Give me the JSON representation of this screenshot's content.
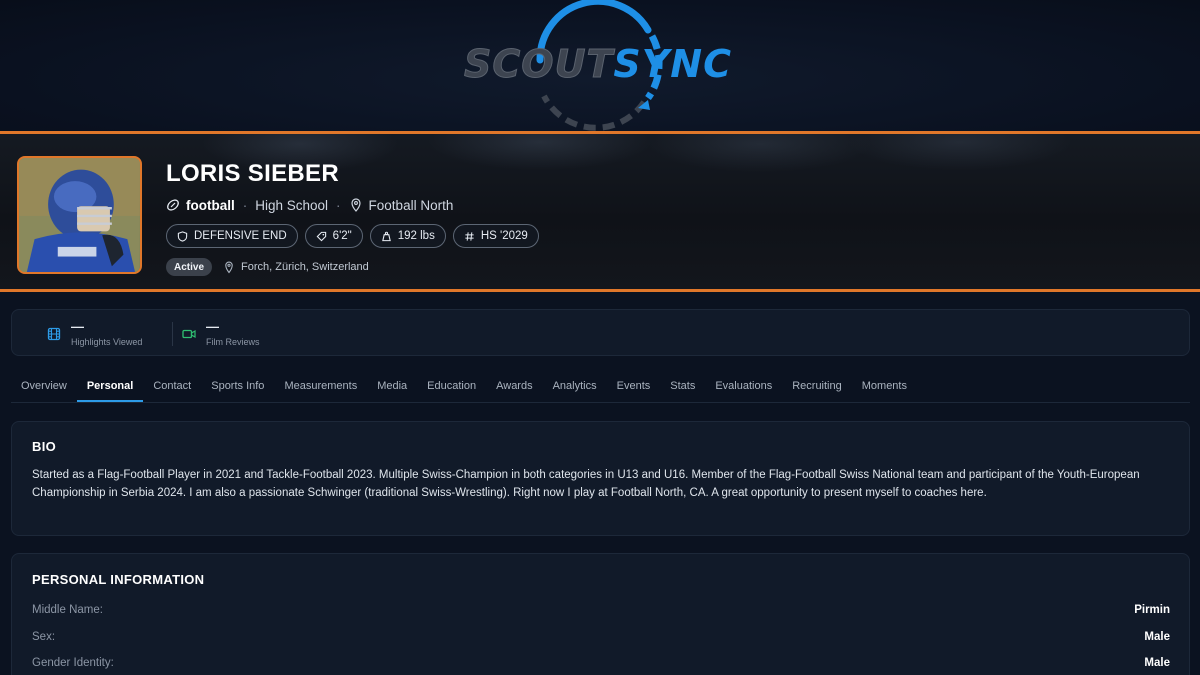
{
  "brand": {
    "logo_left": "SCOUT",
    "logo_right": "SYNC",
    "accent_orange": "#e0772a",
    "accent_blue": "#1e8fe6"
  },
  "profile": {
    "name": "LORIS SIEBER",
    "sport": "football",
    "level": "High School",
    "team": "Football North",
    "chips": [
      {
        "icon": "shield-icon",
        "label": "DEFENSIVE END"
      },
      {
        "icon": "tag-icon",
        "label": "6'2\""
      },
      {
        "icon": "weight-icon",
        "label": "192 lbs"
      },
      {
        "icon": "hash-icon",
        "label": "HS '2029"
      }
    ],
    "status": "Active",
    "location": "Forch, Zürich, Switzerland"
  },
  "stats": [
    {
      "icon": "film-icon",
      "value": "—",
      "label": "Highlights Viewed"
    },
    {
      "icon": "video-icon",
      "value": "—",
      "label": "Film Reviews"
    }
  ],
  "tabs": [
    {
      "label": "Overview"
    },
    {
      "label": "Personal",
      "active": true
    },
    {
      "label": "Contact"
    },
    {
      "label": "Sports Info"
    },
    {
      "label": "Measurements"
    },
    {
      "label": "Media"
    },
    {
      "label": "Education"
    },
    {
      "label": "Awards"
    },
    {
      "label": "Analytics"
    },
    {
      "label": "Events"
    },
    {
      "label": "Stats"
    },
    {
      "label": "Evaluations"
    },
    {
      "label": "Recruiting"
    },
    {
      "label": "Moments"
    }
  ],
  "bio": {
    "title": "BIO",
    "text": "Started as a Flag-Football Player in 2021 and Tackle-Football 2023. Multiple Swiss-Champion in both categories in U13 and U16. Member of the Flag-Football Swiss National team and participant of the Youth-European Championship in Serbia 2024. I am also a passionate Schwinger (traditional Swiss-Wrestling). Right now I play at Football North, CA. A great opportunity to present myself to coaches here."
  },
  "personal_info": {
    "title": "PERSONAL INFORMATION",
    "rows": [
      {
        "label": "Middle Name:",
        "value": "Pirmin"
      },
      {
        "label": "Sex:",
        "value": "Male"
      },
      {
        "label": "Gender Identity:",
        "value": "Male"
      }
    ]
  }
}
